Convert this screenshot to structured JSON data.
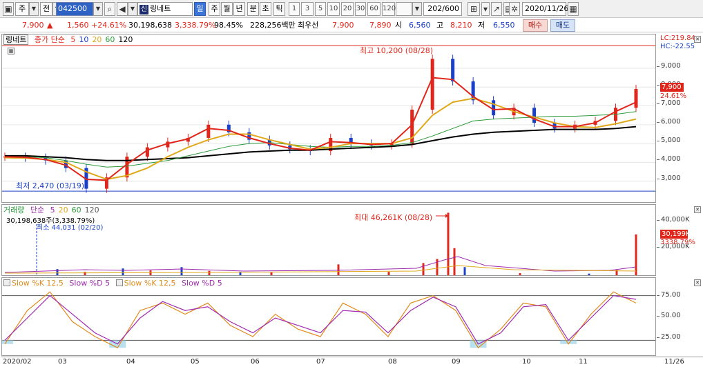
{
  "toolbar": {
    "market": "주",
    "period_prefix": "전",
    "code": "042500",
    "name_badge": "신",
    "name": "링네트",
    "periods": [
      "일",
      "주",
      "월",
      "년",
      "분",
      "초",
      "틱"
    ],
    "active_period": "일",
    "nums": [
      "1",
      "3",
      "5",
      "10",
      "20",
      "30",
      "60",
      "120"
    ],
    "count": "202",
    "count_total": "/600",
    "date": "2020/11/26"
  },
  "quote": {
    "price": "7,900",
    "change": "1,560",
    "change_pct": "+24.61%",
    "volume": "30,198,638",
    "volume_pct": "3,338.79%",
    "ratio": "98.45%",
    "amount": "228,256백만",
    "pref_label": "최우선",
    "ask": "7,900",
    "bid": "7,890",
    "open_label": "시",
    "open": "6,560",
    "high_label": "고",
    "high": "8,210",
    "low_label": "저",
    "low": "6,550",
    "buy_label": "매수",
    "sell_label": "매도"
  },
  "price_panel": {
    "name": "링네트",
    "legend_title": "종가 단순",
    "ma": [
      "5",
      "10",
      "20",
      "60",
      "120"
    ],
    "ma_colors": [
      "#e0261b",
      "#1a40c8",
      "#e0a81b",
      "#2a9a3a",
      "#000000"
    ],
    "lc": "LC:219.84",
    "hc": "HC:-22.55",
    "high_note": "최고 10,200 (08/28)",
    "low_note": "최저 2,470 (03/19)",
    "ticks": [
      "9,000",
      "8,000",
      "7,000",
      "6,000",
      "5,000",
      "4,000",
      "3,000"
    ],
    "last_price": "7,900",
    "last_pct": "24.61%"
  },
  "volume_panel": {
    "title": "거래량",
    "legend_title": "단순",
    "ma": [
      "5",
      "20",
      "60",
      "120"
    ],
    "ma_colors": [
      "#a02ab0",
      "#e0a81b",
      "#2a9a3a",
      "#555555"
    ],
    "vol_note": "30,198,638주(3,338.79%)",
    "min_note": "최소 44,031 (02/20)",
    "max_note": "최대 46,261K (08/28)",
    "ticks": [
      "40,000K",
      "20,000K"
    ],
    "last_vol": "30,199K",
    "last_pct": "3338.79%"
  },
  "stoch_panel": {
    "legend1": "Slow %K 12,5",
    "legend2": "Slow %D 5",
    "legend3": "Slow %K 12,5",
    "legend4": "Slow %D 5",
    "ticks": [
      "75.00",
      "50.00",
      "25.00"
    ]
  },
  "xaxis": {
    "labels": [
      "2020/02",
      "03",
      "04",
      "05",
      "06",
      "07",
      "08",
      "09",
      "10",
      "11",
      "11/26"
    ]
  },
  "chart_data": [
    {
      "type": "candlestick",
      "title": "링네트",
      "ylim": [
        2000,
        10500
      ],
      "x": [
        "02/03",
        "02/17",
        "03/02",
        "03/11",
        "03/19",
        "03/27",
        "04/06",
        "04/16",
        "04/27",
        "05/08",
        "05/18",
        "05/28",
        "06/08",
        "06/18",
        "06/29",
        "07/09",
        "07/20",
        "07/30",
        "08/10",
        "08/20",
        "08/26",
        "08/28",
        "09/03",
        "09/14",
        "09/24",
        "10/08",
        "10/20",
        "10/30",
        "11/10",
        "11/18",
        "11/24",
        "11/26"
      ],
      "close": [
        4300,
        4250,
        4100,
        3700,
        2600,
        3200,
        4300,
        4800,
        5100,
        5300,
        6000,
        5600,
        5200,
        4900,
        4700,
        4600,
        5300,
        5000,
        4900,
        5000,
        6800,
        9500,
        8300,
        7300,
        6500,
        6900,
        6100,
        5800,
        6000,
        6200,
        6900,
        7900
      ],
      "ma5": [
        4300,
        4270,
        4150,
        3850,
        3100,
        3050,
        3900,
        4650,
        5000,
        5250,
        5800,
        5700,
        5300,
        5000,
        4750,
        4650,
        5100,
        5050,
        4950,
        5000,
        6000,
        8500,
        8400,
        7500,
        6800,
        6850,
        6300,
        5900,
        5900,
        6100,
        6700,
        7200
      ],
      "ma20": [
        4250,
        4230,
        4150,
        4000,
        3500,
        3100,
        3300,
        3700,
        4300,
        4800,
        5200,
        5500,
        5500,
        5200,
        4950,
        4700,
        4800,
        5000,
        5000,
        5000,
        5300,
        6500,
        7200,
        7400,
        7100,
        6700,
        6400,
        6100,
        5900,
        5850,
        6050,
        6300
      ],
      "ma60": [
        4300,
        4300,
        4250,
        4100,
        3900,
        3750,
        3800,
        3950,
        4100,
        4350,
        4600,
        4850,
        5000,
        5050,
        4950,
        4850,
        4800,
        4850,
        4850,
        4900,
        5050,
        5400,
        5800,
        6200,
        6300,
        6350,
        6400,
        6450,
        6450,
        6500,
        6550,
        6700
      ],
      "ma120": [
        4350,
        4350,
        4300,
        4250,
        4150,
        4100,
        4100,
        4150,
        4200,
        4250,
        4350,
        4450,
        4550,
        4600,
        4650,
        4650,
        4700,
        4750,
        4800,
        4850,
        4950,
        5150,
        5350,
        5500,
        5600,
        5650,
        5700,
        5750,
        5750,
        5750,
        5800,
        5900
      ]
    },
    {
      "type": "bar",
      "title": "거래량",
      "ylim": [
        0,
        48000
      ],
      "x": [
        "02/20",
        "03/05",
        "03/19",
        "04/08",
        "04/22",
        "05/11",
        "05/22",
        "06/10",
        "06/25",
        "07/15",
        "08/03",
        "08/20",
        "08/26",
        "08/28",
        "09/02",
        "09/10",
        "10/15",
        "11/05",
        "11/20",
        "11/26"
      ],
      "values": [
        0,
        4500,
        2500,
        5000,
        3500,
        6000,
        3200,
        2500,
        2000,
        8000,
        2500,
        9000,
        12000,
        46261,
        20000,
        6000,
        1500,
        1200,
        4000,
        30199
      ]
    },
    {
      "type": "line",
      "title": "Slow Stochastic",
      "ylim": [
        0,
        100
      ],
      "x": [
        "02/03",
        "02/10",
        "02/17",
        "03/02",
        "03/11",
        "03/19",
        "04/01",
        "04/13",
        "04/27",
        "05/08",
        "05/20",
        "06/01",
        "06/12",
        "06/24",
        "07/06",
        "07/16",
        "07/28",
        "08/07",
        "08/18",
        "08/28",
        "09/08",
        "09/18",
        "10/05",
        "10/15",
        "10/27",
        "11/05",
        "11/13",
        "11/20",
        "11/26"
      ],
      "series": [
        {
          "name": "Slow %K 12,5",
          "values": [
            15,
            60,
            85,
            45,
            25,
            10,
            60,
            70,
            55,
            70,
            40,
            25,
            55,
            35,
            25,
            70,
            55,
            25,
            70,
            80,
            60,
            10,
            35,
            70,
            65,
            15,
            55,
            85,
            70
          ]
        },
        {
          "name": "Slow %D 5",
          "values": [
            20,
            50,
            80,
            55,
            30,
            15,
            50,
            72,
            60,
            65,
            45,
            30,
            50,
            40,
            30,
            60,
            58,
            30,
            60,
            78,
            65,
            15,
            30,
            65,
            68,
            20,
            50,
            80,
            75
          ]
        }
      ]
    }
  ]
}
